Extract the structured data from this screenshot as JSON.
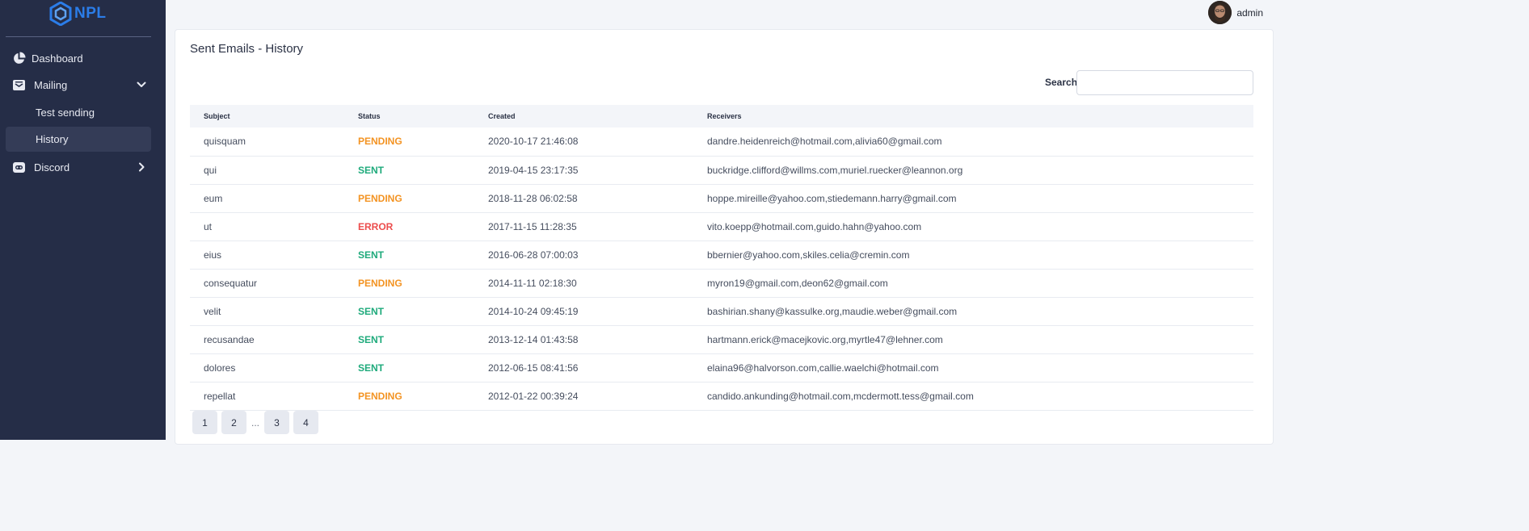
{
  "brand": {
    "name": "NPL",
    "color": "#2b7de9"
  },
  "sidebar": {
    "items": [
      {
        "label": "Dashboard",
        "icon": "pie-chart-icon"
      },
      {
        "label": "Mailing",
        "icon": "mail-inbox-icon",
        "expanded": true,
        "children": [
          {
            "label": "Test sending"
          },
          {
            "label": "History",
            "active": true
          }
        ]
      },
      {
        "label": "Discord",
        "icon": "discord-icon",
        "expanded": false
      }
    ]
  },
  "topbar": {
    "user_name": "admin"
  },
  "page": {
    "title": "Sent Emails - History",
    "search_label": "Search",
    "search_value": "",
    "search_placeholder": ""
  },
  "table": {
    "columns": [
      "Subject",
      "Status",
      "Created",
      "Receivers"
    ],
    "rows": [
      {
        "subject": "quisquam",
        "status": "PENDING",
        "created": "2020-10-17 21:46:08",
        "receivers": "dandre.heidenreich@hotmail.com,alivia60@gmail.com"
      },
      {
        "subject": "qui",
        "status": "SENT",
        "created": "2019-04-15 23:17:35",
        "receivers": "buckridge.clifford@willms.com,muriel.ruecker@leannon.org"
      },
      {
        "subject": "eum",
        "status": "PENDING",
        "created": "2018-11-28 06:02:58",
        "receivers": "hoppe.mireille@yahoo.com,stiedemann.harry@gmail.com"
      },
      {
        "subject": "ut",
        "status": "ERROR",
        "created": "2017-11-15 11:28:35",
        "receivers": "vito.koepp@hotmail.com,guido.hahn@yahoo.com"
      },
      {
        "subject": "eius",
        "status": "SENT",
        "created": "2016-06-28 07:00:03",
        "receivers": "bbernier@yahoo.com,skiles.celia@cremin.com"
      },
      {
        "subject": "consequatur",
        "status": "PENDING",
        "created": "2014-11-11 02:18:30",
        "receivers": "myron19@gmail.com,deon62@gmail.com"
      },
      {
        "subject": "velit",
        "status": "SENT",
        "created": "2014-10-24 09:45:19",
        "receivers": "bashirian.shany@kassulke.org,maudie.weber@gmail.com"
      },
      {
        "subject": "recusandae",
        "status": "SENT",
        "created": "2013-12-14 01:43:58",
        "receivers": "hartmann.erick@macejkovic.org,myrtle47@lehner.com"
      },
      {
        "subject": "dolores",
        "status": "SENT",
        "created": "2012-06-15 08:41:56",
        "receivers": "elaina96@halvorson.com,callie.waelchi@hotmail.com"
      },
      {
        "subject": "repellat",
        "status": "PENDING",
        "created": "2012-01-22 00:39:24",
        "receivers": "candido.ankunding@hotmail.com,mcdermott.tess@gmail.com"
      }
    ]
  },
  "status_colors": {
    "PENDING": "#f39322",
    "SENT": "#1eaa7b",
    "ERROR": "#ec4c4c"
  },
  "pagination": {
    "pages": [
      "1",
      "2",
      "3",
      "4"
    ],
    "ellipsis": "..."
  }
}
